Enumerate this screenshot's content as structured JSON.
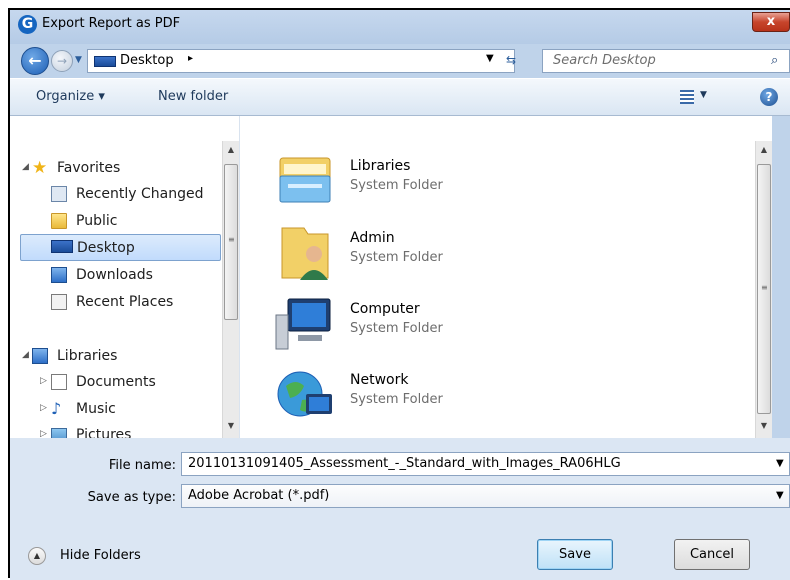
{
  "window": {
    "title": "Export Report as PDF",
    "close_label": "x",
    "app_icon_letter": "G"
  },
  "address_bar": {
    "location": "Desktop",
    "chevron": "▸",
    "dropdown": "▼",
    "refresh": "⇆"
  },
  "search": {
    "placeholder": "Search Desktop",
    "icon": "⌕"
  },
  "toolbar": {
    "organize_label": "Organize ▾",
    "new_folder_label": "New folder",
    "help_label": "?"
  },
  "nav_pane": {
    "favorites": {
      "label": "Favorites",
      "items": [
        {
          "label": "Recently Changed",
          "icon": "recently-changed-icon"
        },
        {
          "label": "Public",
          "icon": "folder-icon"
        },
        {
          "label": "Desktop",
          "icon": "desktop-icon",
          "selected": true
        },
        {
          "label": "Downloads",
          "icon": "downloads-icon"
        },
        {
          "label": "Recent Places",
          "icon": "recent-places-icon"
        }
      ]
    },
    "libraries": {
      "label": "Libraries",
      "items": [
        {
          "label": "Documents",
          "icon": "documents-icon"
        },
        {
          "label": "Music",
          "icon": "music-icon"
        },
        {
          "label": "Pictures",
          "icon": "pictures-icon"
        }
      ]
    }
  },
  "content": {
    "items": [
      {
        "name": "Libraries",
        "type": "System Folder",
        "icon": "libraries-icon"
      },
      {
        "name": "Admin",
        "type": "System Folder",
        "icon": "user-folder-icon"
      },
      {
        "name": "Computer",
        "type": "System Folder",
        "icon": "computer-icon"
      },
      {
        "name": "Network",
        "type": "System Folder",
        "icon": "network-icon"
      }
    ]
  },
  "form": {
    "file_name_label": "File name:",
    "file_name_value": "20110131091405_Assessment_-_Standard_with_Images_RA06HLG",
    "save_type_label": "Save as type:",
    "save_type_value": "Adobe Acrobat (*.pdf)"
  },
  "footer": {
    "hide_folders_label": "Hide Folders",
    "save_label": "Save",
    "cancel_label": "Cancel"
  },
  "colors": {
    "frame": "#bfd3ea",
    "selection": "#c1dbfc",
    "close": "#c7452c"
  }
}
